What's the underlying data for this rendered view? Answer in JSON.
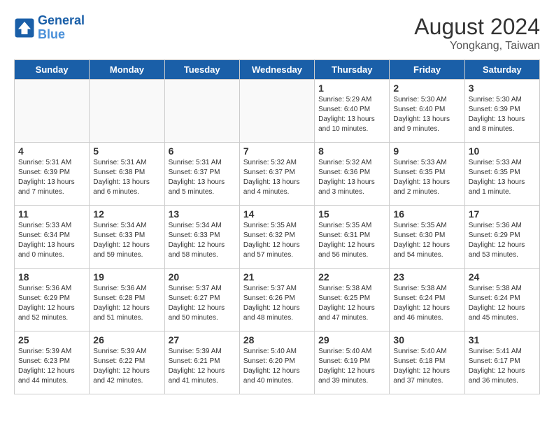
{
  "header": {
    "logo_general": "General",
    "logo_blue": "Blue",
    "month_year": "August 2024",
    "location": "Yongkang, Taiwan"
  },
  "days_of_week": [
    "Sunday",
    "Monday",
    "Tuesday",
    "Wednesday",
    "Thursday",
    "Friday",
    "Saturday"
  ],
  "weeks": [
    [
      {
        "day": "",
        "sunrise": "",
        "sunset": "",
        "daylight": "",
        "empty": true
      },
      {
        "day": "",
        "sunrise": "",
        "sunset": "",
        "daylight": "",
        "empty": true
      },
      {
        "day": "",
        "sunrise": "",
        "sunset": "",
        "daylight": "",
        "empty": true
      },
      {
        "day": "",
        "sunrise": "",
        "sunset": "",
        "daylight": "",
        "empty": true
      },
      {
        "day": "1",
        "sunrise": "Sunrise: 5:29 AM",
        "sunset": "Sunset: 6:40 PM",
        "daylight": "Daylight: 13 hours and 10 minutes."
      },
      {
        "day": "2",
        "sunrise": "Sunrise: 5:30 AM",
        "sunset": "Sunset: 6:40 PM",
        "daylight": "Daylight: 13 hours and 9 minutes."
      },
      {
        "day": "3",
        "sunrise": "Sunrise: 5:30 AM",
        "sunset": "Sunset: 6:39 PM",
        "daylight": "Daylight: 13 hours and 8 minutes."
      }
    ],
    [
      {
        "day": "4",
        "sunrise": "Sunrise: 5:31 AM",
        "sunset": "Sunset: 6:39 PM",
        "daylight": "Daylight: 13 hours and 7 minutes."
      },
      {
        "day": "5",
        "sunrise": "Sunrise: 5:31 AM",
        "sunset": "Sunset: 6:38 PM",
        "daylight": "Daylight: 13 hours and 6 minutes."
      },
      {
        "day": "6",
        "sunrise": "Sunrise: 5:31 AM",
        "sunset": "Sunset: 6:37 PM",
        "daylight": "Daylight: 13 hours and 5 minutes."
      },
      {
        "day": "7",
        "sunrise": "Sunrise: 5:32 AM",
        "sunset": "Sunset: 6:37 PM",
        "daylight": "Daylight: 13 hours and 4 minutes."
      },
      {
        "day": "8",
        "sunrise": "Sunrise: 5:32 AM",
        "sunset": "Sunset: 6:36 PM",
        "daylight": "Daylight: 13 hours and 3 minutes."
      },
      {
        "day": "9",
        "sunrise": "Sunrise: 5:33 AM",
        "sunset": "Sunset: 6:35 PM",
        "daylight": "Daylight: 13 hours and 2 minutes."
      },
      {
        "day": "10",
        "sunrise": "Sunrise: 5:33 AM",
        "sunset": "Sunset: 6:35 PM",
        "daylight": "Daylight: 13 hours and 1 minute."
      }
    ],
    [
      {
        "day": "11",
        "sunrise": "Sunrise: 5:33 AM",
        "sunset": "Sunset: 6:34 PM",
        "daylight": "Daylight: 13 hours and 0 minutes."
      },
      {
        "day": "12",
        "sunrise": "Sunrise: 5:34 AM",
        "sunset": "Sunset: 6:33 PM",
        "daylight": "Daylight: 12 hours and 59 minutes."
      },
      {
        "day": "13",
        "sunrise": "Sunrise: 5:34 AM",
        "sunset": "Sunset: 6:33 PM",
        "daylight": "Daylight: 12 hours and 58 minutes."
      },
      {
        "day": "14",
        "sunrise": "Sunrise: 5:35 AM",
        "sunset": "Sunset: 6:32 PM",
        "daylight": "Daylight: 12 hours and 57 minutes."
      },
      {
        "day": "15",
        "sunrise": "Sunrise: 5:35 AM",
        "sunset": "Sunset: 6:31 PM",
        "daylight": "Daylight: 12 hours and 56 minutes."
      },
      {
        "day": "16",
        "sunrise": "Sunrise: 5:35 AM",
        "sunset": "Sunset: 6:30 PM",
        "daylight": "Daylight: 12 hours and 54 minutes."
      },
      {
        "day": "17",
        "sunrise": "Sunrise: 5:36 AM",
        "sunset": "Sunset: 6:29 PM",
        "daylight": "Daylight: 12 hours and 53 minutes."
      }
    ],
    [
      {
        "day": "18",
        "sunrise": "Sunrise: 5:36 AM",
        "sunset": "Sunset: 6:29 PM",
        "daylight": "Daylight: 12 hours and 52 minutes."
      },
      {
        "day": "19",
        "sunrise": "Sunrise: 5:36 AM",
        "sunset": "Sunset: 6:28 PM",
        "daylight": "Daylight: 12 hours and 51 minutes."
      },
      {
        "day": "20",
        "sunrise": "Sunrise: 5:37 AM",
        "sunset": "Sunset: 6:27 PM",
        "daylight": "Daylight: 12 hours and 50 minutes."
      },
      {
        "day": "21",
        "sunrise": "Sunrise: 5:37 AM",
        "sunset": "Sunset: 6:26 PM",
        "daylight": "Daylight: 12 hours and 48 minutes."
      },
      {
        "day": "22",
        "sunrise": "Sunrise: 5:38 AM",
        "sunset": "Sunset: 6:25 PM",
        "daylight": "Daylight: 12 hours and 47 minutes."
      },
      {
        "day": "23",
        "sunrise": "Sunrise: 5:38 AM",
        "sunset": "Sunset: 6:24 PM",
        "daylight": "Daylight: 12 hours and 46 minutes."
      },
      {
        "day": "24",
        "sunrise": "Sunrise: 5:38 AM",
        "sunset": "Sunset: 6:24 PM",
        "daylight": "Daylight: 12 hours and 45 minutes."
      }
    ],
    [
      {
        "day": "25",
        "sunrise": "Sunrise: 5:39 AM",
        "sunset": "Sunset: 6:23 PM",
        "daylight": "Daylight: 12 hours and 44 minutes."
      },
      {
        "day": "26",
        "sunrise": "Sunrise: 5:39 AM",
        "sunset": "Sunset: 6:22 PM",
        "daylight": "Daylight: 12 hours and 42 minutes."
      },
      {
        "day": "27",
        "sunrise": "Sunrise: 5:39 AM",
        "sunset": "Sunset: 6:21 PM",
        "daylight": "Daylight: 12 hours and 41 minutes."
      },
      {
        "day": "28",
        "sunrise": "Sunrise: 5:40 AM",
        "sunset": "Sunset: 6:20 PM",
        "daylight": "Daylight: 12 hours and 40 minutes."
      },
      {
        "day": "29",
        "sunrise": "Sunrise: 5:40 AM",
        "sunset": "Sunset: 6:19 PM",
        "daylight": "Daylight: 12 hours and 39 minutes."
      },
      {
        "day": "30",
        "sunrise": "Sunrise: 5:40 AM",
        "sunset": "Sunset: 6:18 PM",
        "daylight": "Daylight: 12 hours and 37 minutes."
      },
      {
        "day": "31",
        "sunrise": "Sunrise: 5:41 AM",
        "sunset": "Sunset: 6:17 PM",
        "daylight": "Daylight: 12 hours and 36 minutes."
      }
    ]
  ]
}
